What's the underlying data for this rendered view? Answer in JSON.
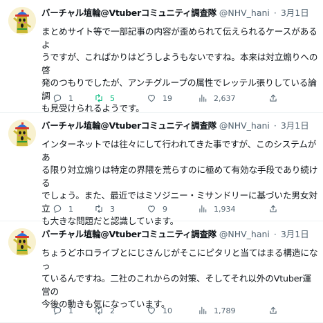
{
  "colors": {
    "text": "#0f1419",
    "muted": "#536471",
    "retweet_active": "#00ba7c",
    "divider": "#eff3f4"
  },
  "icons": {
    "reply": "speech-bubble-icon",
    "retweet": "retweet-icon",
    "like": "heart-icon",
    "views": "bar-chart-icon",
    "share": "share-icon"
  },
  "tweets": [
    {
      "author_name": "バーチャル埴輪@Vtuberコミュニティ調査隊",
      "handle": "@NHV_hani",
      "separator": "·",
      "date": "3月1日",
      "text_lines": [
        "まとめサイト等で一部記事の内容が歪められて伝えられるケースがあるよ",
        "うですが、これぱかりはどうしようもないですね。本来は対立煽りへの啓",
        "発のつもりでしたが、アンチグループの属性でレッテル張りしている論調",
        "も見受けられるようです。"
      ],
      "replies": "1",
      "retweets": "5",
      "likes": "19",
      "views": "2,637",
      "retweeted": true
    },
    {
      "author_name": "バーチャル埴輪@Vtuberコミュニティ調査隊",
      "handle": "@NHV_hani",
      "separator": "·",
      "date": "3月1日",
      "text_lines": [
        "インターネットでは往々にして行われてきた事ですが、このシステムがあ",
        "る限り対立煽りは特定の界隈を荒らすのに極めて有効な手段であり続ける",
        "でしょう。また、最近ではミソジニー・ミサンドリーに基づいた男女対立",
        "も大きな問題だと認識しています。"
      ],
      "replies": "1",
      "retweets": "3",
      "likes": "9",
      "views": "1,934",
      "retweeted": false
    },
    {
      "author_name": "バーチャル埴輪@Vtuberコミュニティ調査隊",
      "handle": "@NHV_hani",
      "separator": "·",
      "date": "3月1日",
      "text_lines": [
        "ちょうどホロライブとにじさんじがそこにピタリと当てはまる構造になっ",
        "ているんですね。二社のこれからの対策、そしてそれ以外のVtuber運営の",
        "今後の動きも気になっています。"
      ],
      "replies": "1",
      "retweets": "2",
      "likes": "10",
      "views": "1,789",
      "retweeted": false
    }
  ]
}
